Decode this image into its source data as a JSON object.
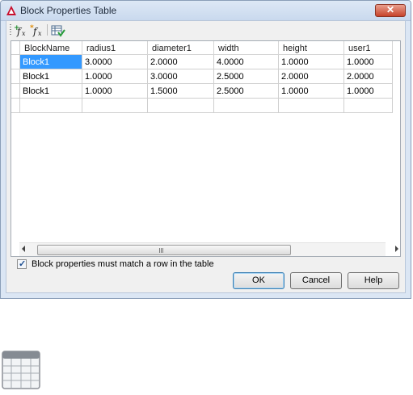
{
  "window": {
    "title": "Block Properties Table"
  },
  "toolbar": {
    "buttons": [
      {
        "name": "add-property-icon",
        "symbol": "fx"
      },
      {
        "name": "add-user-parameter-icon",
        "symbol": "fx"
      },
      {
        "name": "audit-icon",
        "symbol": "table-check"
      }
    ]
  },
  "table": {
    "columns": [
      "BlockName",
      "radius1",
      "diameter1",
      "width",
      "height",
      "user1"
    ],
    "rows": [
      [
        "Block1",
        "3.0000",
        "2.0000",
        "4.0000",
        "1.0000",
        "1.0000"
      ],
      [
        "Block1",
        "1.0000",
        "3.0000",
        "2.5000",
        "2.0000",
        "2.0000"
      ],
      [
        "Block1",
        "1.0000",
        "1.5000",
        "2.5000",
        "1.0000",
        "1.0000"
      ],
      [
        "",
        "",
        "",
        "",
        "",
        ""
      ]
    ],
    "selected_cell": {
      "row": 0,
      "col": 0
    }
  },
  "checkbox": {
    "label": "Block properties must match a row in the table",
    "checked": true
  },
  "buttons": {
    "ok": "OK",
    "cancel": "Cancel",
    "help": "Help"
  },
  "colors": {
    "selection": "#3399ff",
    "close": "#c7432b"
  }
}
